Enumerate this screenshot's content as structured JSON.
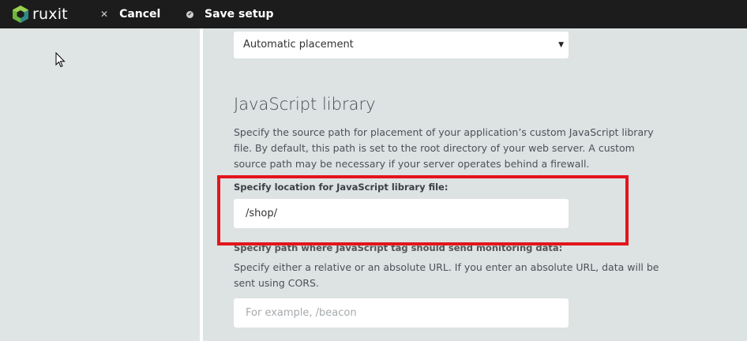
{
  "app": {
    "brand": "ruxit"
  },
  "toolbar": {
    "cancel_label": "Cancel",
    "save_label": "Save setup"
  },
  "placement": {
    "selected": "Automatic placement"
  },
  "js_library": {
    "title": "JavaScript library",
    "description": "Specify the source path for placement of your application’s custom JavaScript library file. By default, this path is set to the root directory of your web server. A custom source path may be necessary if your server operates behind a firewall.",
    "location_label": "Specify location for JavaScript library file:",
    "location_value": "/shop/"
  },
  "monitoring": {
    "label": "Specify path where JavaScript tag should send monitoring data:",
    "description": "Specify either a relative or an absolute URL. If you enter an absolute URL, data will be sent using CORS.",
    "placeholder": "For example, /beacon"
  },
  "colors": {
    "topbar": "#1c1c1c",
    "highlight": "#e2161c",
    "background": "#dfe3e3"
  },
  "icons": [
    "ruxit-logo-icon",
    "close-icon",
    "check-circle-icon",
    "dropdown-arrow-icon",
    "mouse-pointer-icon"
  ]
}
